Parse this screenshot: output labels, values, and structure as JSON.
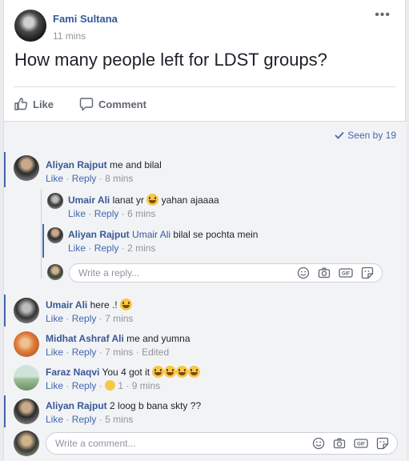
{
  "post": {
    "author": "Fami Sultana",
    "time": "11 mins",
    "text": "How many people left for LDST groups?",
    "more_icon": "•••"
  },
  "actions": {
    "like": "Like",
    "comment": "Comment"
  },
  "seen_by": "Seen by 19",
  "comments": [
    {
      "name": "Aliyan Rajput",
      "text": "me and bilal",
      "like": "Like",
      "reply": "Reply",
      "time": "8 mins"
    },
    {
      "name": "Umair Ali",
      "text_before": "lanat yr",
      "text_after": "yahan ajaaaa",
      "like": "Like",
      "reply": "Reply",
      "time": "6 mins"
    },
    {
      "name": "Aliyan Rajput",
      "mention": "Umair Ali",
      "text": "bilal se pochta mein",
      "like": "Like",
      "reply": "Reply",
      "time": "2 mins"
    },
    {
      "name": "Umair Ali",
      "text": "here .!",
      "like": "Like",
      "reply": "Reply",
      "time": "7 mins"
    },
    {
      "name": "Midhat Ashraf Ali",
      "text": "me and yumna",
      "like": "Like",
      "reply": "Reply",
      "time": "7 mins",
      "edited": "Edited"
    },
    {
      "name": "Faraz Naqvi",
      "text": "You 4 got it",
      "like": "Like",
      "reply": "Reply",
      "reactions": "1",
      "time": "9 mins"
    },
    {
      "name": "Aliyan Rajput",
      "text": "2 loog b bana skty ??",
      "like": "Like",
      "reply": "Reply",
      "time": "5 mins"
    }
  ],
  "reply_placeholder": "Write a reply...",
  "comment_placeholder": "Write a comment...",
  "gif_label": "GIF",
  "sep": "·",
  "colors": {
    "link": "#385898",
    "accent": "#4267b2",
    "meta": "#90949c"
  }
}
